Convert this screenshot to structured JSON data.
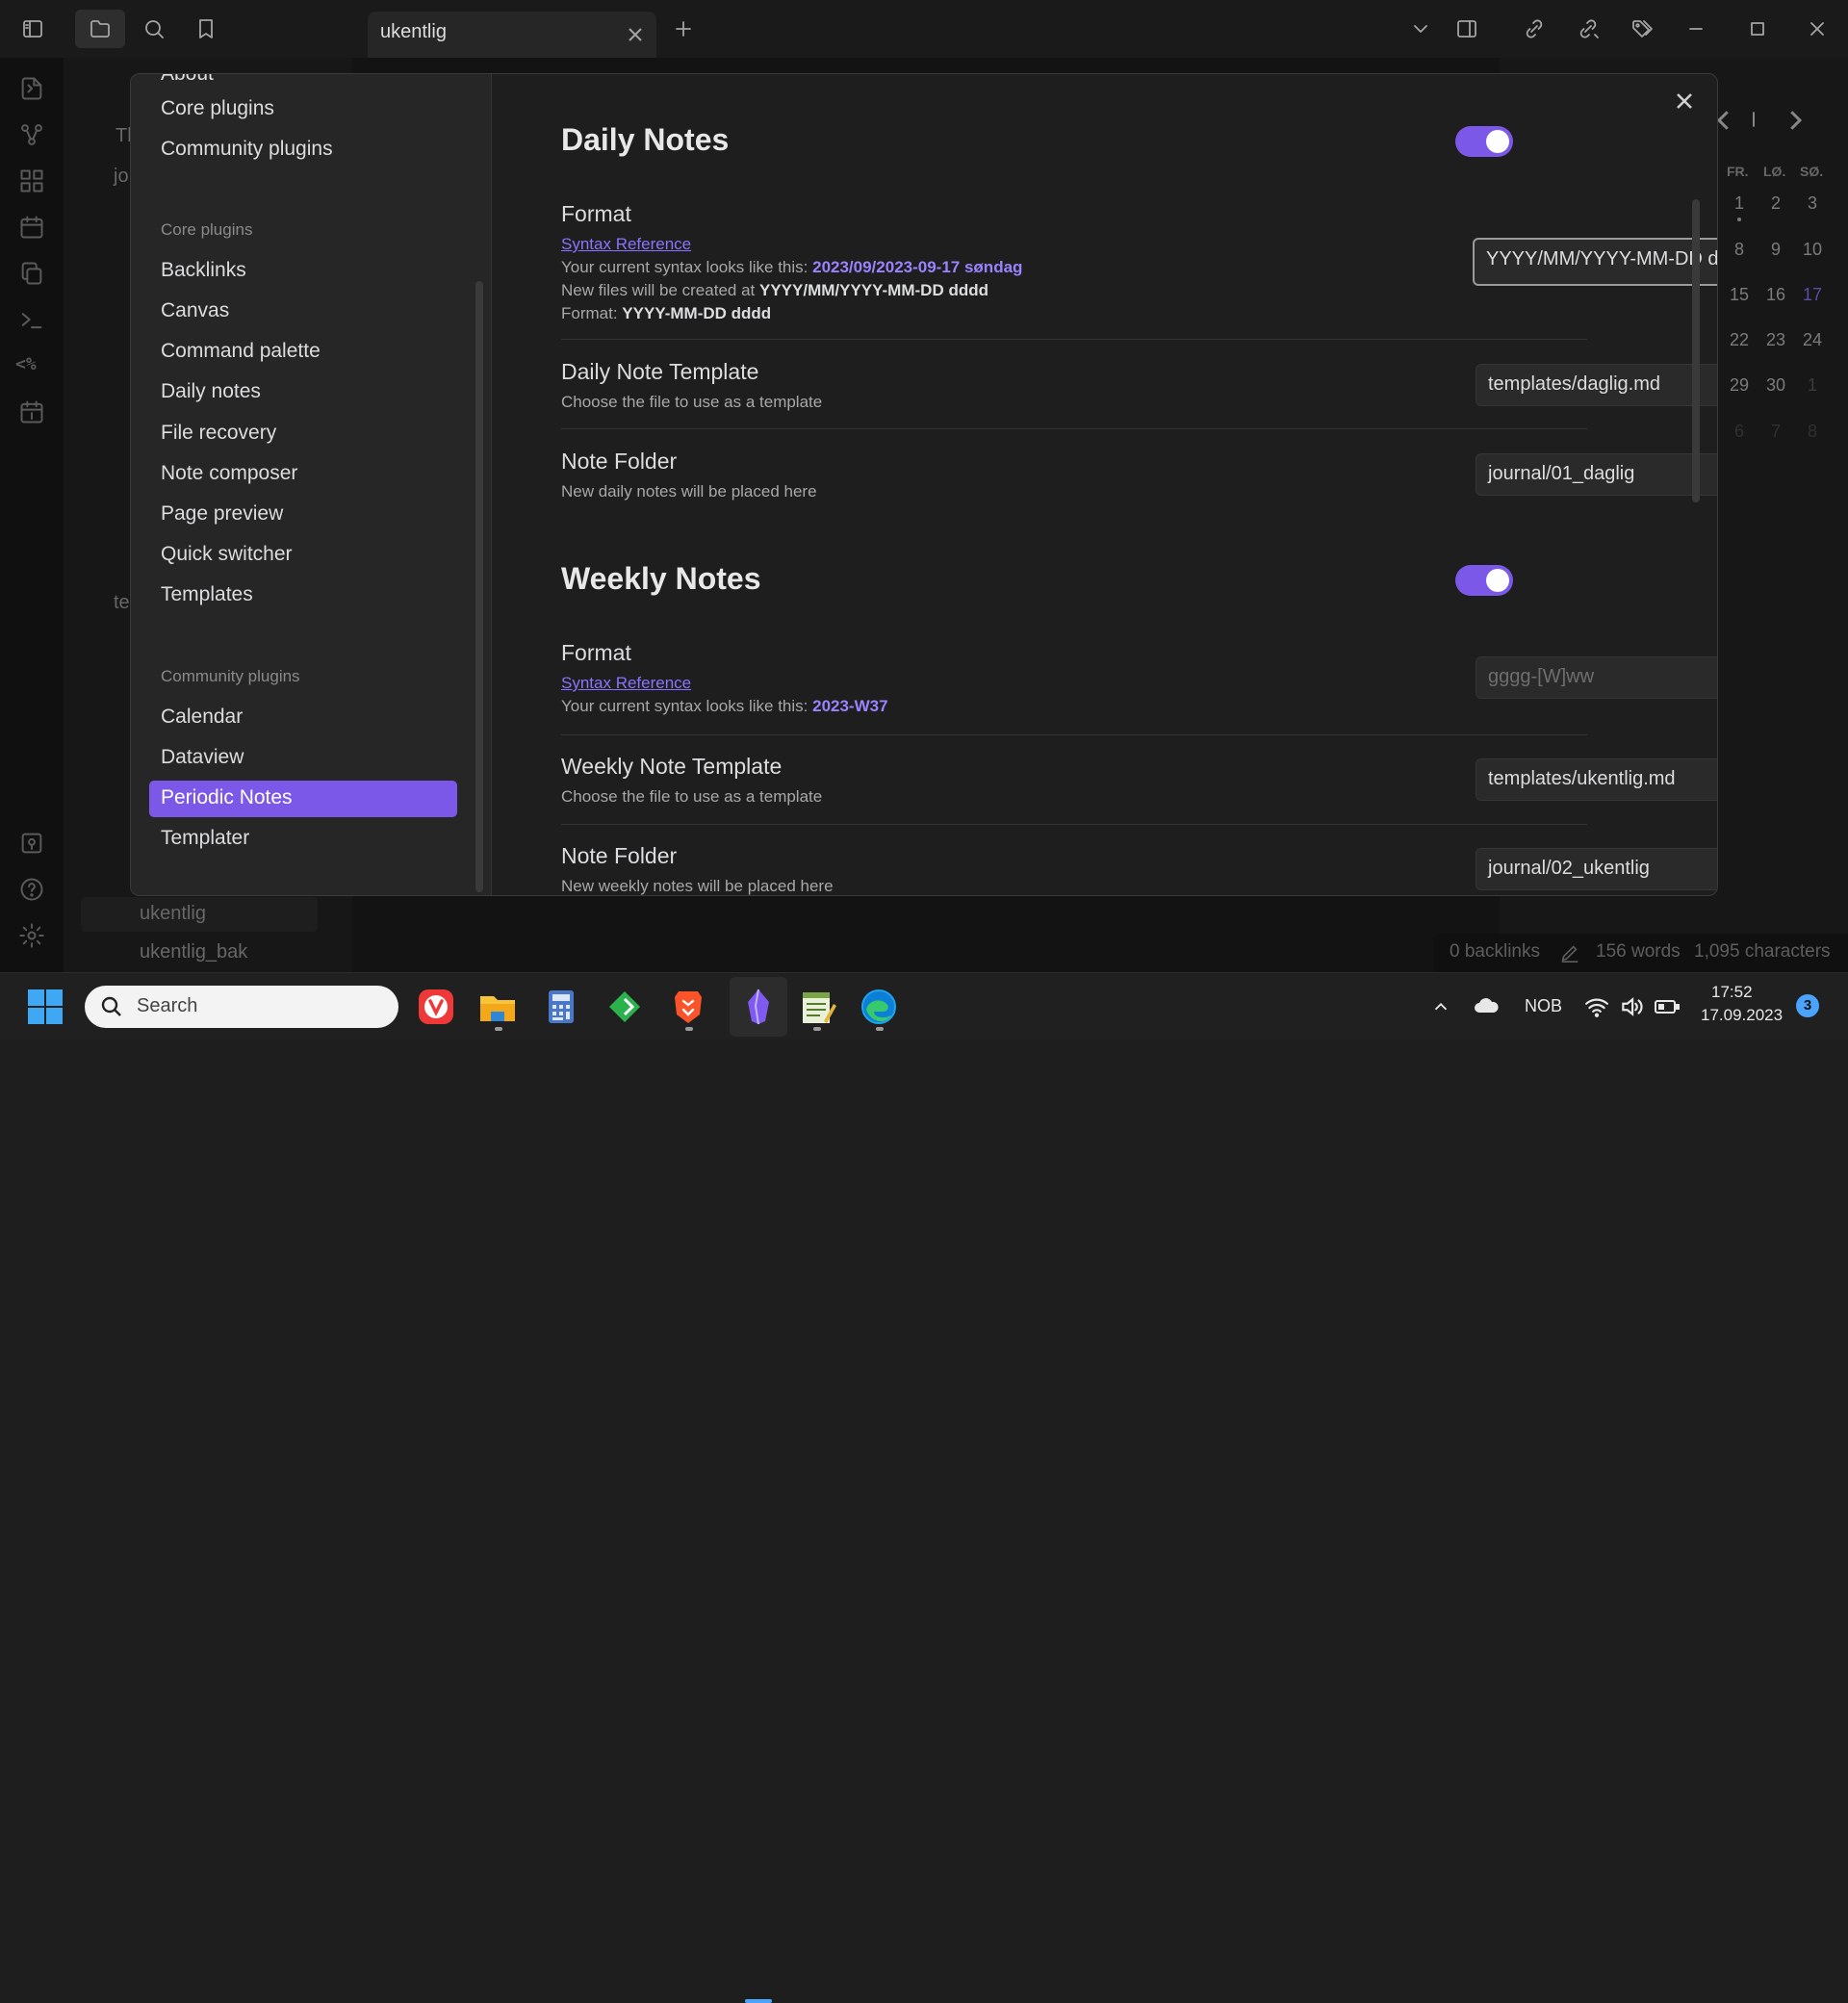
{
  "tab": {
    "title": "ukentlig"
  },
  "sidebar": {
    "partial_labels": [
      "Tl",
      "jo",
      "te"
    ],
    "files": [
      "ukentlig",
      "ukentlig_bak"
    ]
  },
  "calendar": {
    "weekdays": [
      "FR.",
      "LØ.",
      "SØ."
    ],
    "weeks": [
      [
        "1",
        "2",
        "3"
      ],
      [
        "8",
        "9",
        "10"
      ],
      [
        "15",
        "16",
        "17"
      ],
      [
        "22",
        "23",
        "24"
      ],
      [
        "29",
        "30",
        "1"
      ],
      [
        "6",
        "7",
        "8"
      ]
    ],
    "today_color": "#8a73ff"
  },
  "statusbar": {
    "backlinks": "0 backlinks",
    "words": "156 words",
    "characters": "1,095 characters"
  },
  "settings_nav": {
    "top_items": [
      "About",
      "Core plugins",
      "Community plugins"
    ],
    "core_header": "Core plugins",
    "core_items": [
      "Backlinks",
      "Canvas",
      "Command palette",
      "Daily notes",
      "File recovery",
      "Note composer",
      "Page preview",
      "Quick switcher",
      "Templates"
    ],
    "community_header": "Community plugins",
    "community_items": [
      "Calendar",
      "Dataview",
      "Periodic Notes",
      "Templater"
    ],
    "active": "Periodic Notes"
  },
  "daily": {
    "heading": "Daily Notes",
    "format_label": "Format",
    "syntax_link": "Syntax Reference",
    "syntax_prefix": "Your current syntax looks like this: ",
    "syntax_value": "2023/09/2023-09-17 søndag",
    "created_prefix": "New files will be created at ",
    "created_value": "YYYY/MM/YYYY-MM-DD dddd",
    "format_prefix": "Format: ",
    "format_value": "YYYY-MM-DD dddd",
    "format_input": "YYYY/MM/YYYY-MM-DD ddd",
    "template_label": "Daily Note Template",
    "template_desc": "Choose the file to use as a template",
    "template_value": "templates/daglig.md",
    "folder_label": "Note Folder",
    "folder_desc": "New daily notes will be placed here",
    "folder_value": "journal/01_daglig"
  },
  "weekly": {
    "heading": "Weekly Notes",
    "format_label": "Format",
    "syntax_link": "Syntax Reference",
    "syntax_prefix": "Your current syntax looks like this: ",
    "syntax_value": "2023-W37",
    "format_placeholder": "gggg-[W]ww",
    "template_label": "Weekly Note Template",
    "template_desc": "Choose the file to use as a template",
    "template_value": "templates/ukentlig.md",
    "folder_label": "Note Folder",
    "folder_desc": "New weekly notes will be placed here",
    "folder_value": "journal/02_ukentlig"
  },
  "taskbar": {
    "search_label": "Search",
    "language": "NOB",
    "time": "17:52",
    "date": "17.09.2023",
    "notification_count": "3"
  },
  "colors": {
    "accent": "#7b58e8",
    "link": "#8a73ff"
  }
}
